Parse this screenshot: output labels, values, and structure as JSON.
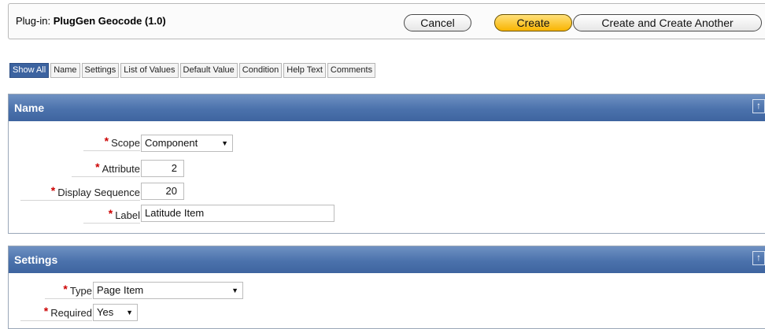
{
  "header": {
    "plugin_prefix": "Plug-in:",
    "plugin_name": "PlugGen Geocode (1.0)",
    "cancel_label": "Cancel",
    "create_label": "Create",
    "create_another_label": "Create and Create Another"
  },
  "tabs": [
    {
      "label": "Show All",
      "active": true
    },
    {
      "label": "Name"
    },
    {
      "label": "Settings"
    },
    {
      "label": "List of Values"
    },
    {
      "label": "Default Value"
    },
    {
      "label": "Condition"
    },
    {
      "label": "Help Text"
    },
    {
      "label": "Comments"
    }
  ],
  "regions": {
    "name": {
      "title": "Name",
      "fields": {
        "scope": {
          "label": "Scope",
          "value": "Component"
        },
        "attribute": {
          "label": "Attribute",
          "value": "2"
        },
        "display_sequence": {
          "label": "Display Sequence",
          "value": "20"
        },
        "label": {
          "label": "Label",
          "value": "Latitude Item"
        }
      }
    },
    "settings": {
      "title": "Settings",
      "fields": {
        "type": {
          "label": "Type",
          "value": "Page Item"
        },
        "required": {
          "label": "Required",
          "value": "Yes"
        }
      }
    }
  },
  "icons": {
    "required_marker": "asterisk",
    "collapse": "arrow-up-icon",
    "dropdown": "triangle-down"
  },
  "colors": {
    "region_header": "#4b72ac",
    "active_tab": "#3c63a0",
    "create_button": "#f8b400",
    "required": "#cc0000"
  }
}
